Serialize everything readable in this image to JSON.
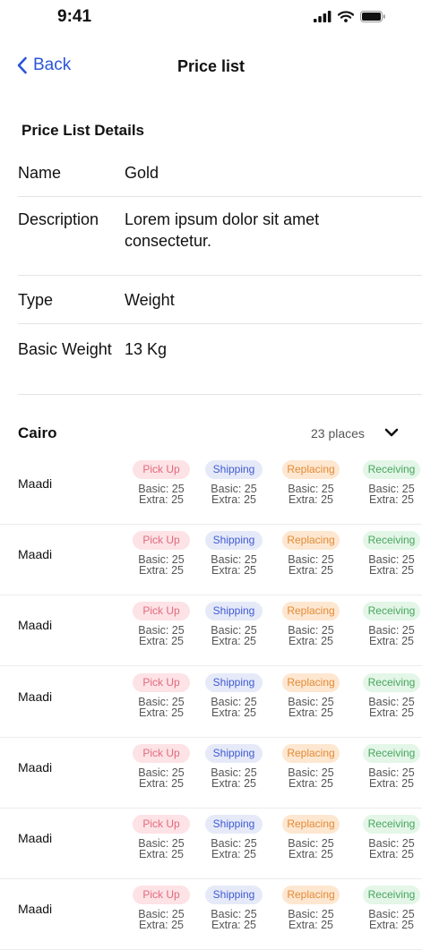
{
  "status": {
    "time": "9:41"
  },
  "nav": {
    "back_label": "Back",
    "title": "Price list"
  },
  "details": {
    "section_title": "Price List Details",
    "rows": [
      {
        "label": "Name",
        "value": "Gold"
      },
      {
        "label": "Description",
        "value": "Lorem ipsum dolor sit amet consectetur."
      },
      {
        "label": "Type",
        "value": "Weight"
      },
      {
        "label": "Basic Weight",
        "value": "13 Kg"
      }
    ]
  },
  "city": {
    "name": "Cairo",
    "count": "23 places"
  },
  "services": [
    {
      "label": "Pick Up",
      "style": "pickup"
    },
    {
      "label": "Shipping",
      "style": "ship"
    },
    {
      "label": "Replacing",
      "style": "replace"
    },
    {
      "label": "Receiving",
      "style": "recv"
    }
  ],
  "places": [
    {
      "name": "Maadi",
      "rates": [
        {
          "basic": "Basic: 25",
          "extra": "Extra: 25"
        },
        {
          "basic": "Basic: 25",
          "extra": "Extra: 25"
        },
        {
          "basic": "Basic: 25",
          "extra": "Extra: 25"
        },
        {
          "basic": "Basic: 25",
          "extra": "Extra: 25"
        }
      ]
    },
    {
      "name": "Maadi",
      "rates": [
        {
          "basic": "Basic: 25",
          "extra": "Extra: 25"
        },
        {
          "basic": "Basic: 25",
          "extra": "Extra: 25"
        },
        {
          "basic": "Basic: 25",
          "extra": "Extra: 25"
        },
        {
          "basic": "Basic: 25",
          "extra": "Extra: 25"
        }
      ]
    },
    {
      "name": "Maadi",
      "rates": [
        {
          "basic": "Basic: 25",
          "extra": "Extra: 25"
        },
        {
          "basic": "Basic: 25",
          "extra": "Extra: 25"
        },
        {
          "basic": "Basic: 25",
          "extra": "Extra: 25"
        },
        {
          "basic": "Basic: 25",
          "extra": "Extra: 25"
        }
      ]
    },
    {
      "name": "Maadi",
      "rates": [
        {
          "basic": "Basic: 25",
          "extra": "Extra: 25"
        },
        {
          "basic": "Basic: 25",
          "extra": "Extra: 25"
        },
        {
          "basic": "Basic: 25",
          "extra": "Extra: 25"
        },
        {
          "basic": "Basic: 25",
          "extra": "Extra: 25"
        }
      ]
    },
    {
      "name": "Maadi",
      "rates": [
        {
          "basic": "Basic: 25",
          "extra": "Extra: 25"
        },
        {
          "basic": "Basic: 25",
          "extra": "Extra: 25"
        },
        {
          "basic": "Basic: 25",
          "extra": "Extra: 25"
        },
        {
          "basic": "Basic: 25",
          "extra": "Extra: 25"
        }
      ]
    },
    {
      "name": "Maadi",
      "rates": [
        {
          "basic": "Basic: 25",
          "extra": "Extra: 25"
        },
        {
          "basic": "Basic: 25",
          "extra": "Extra: 25"
        },
        {
          "basic": "Basic: 25",
          "extra": "Extra: 25"
        },
        {
          "basic": "Basic: 25",
          "extra": "Extra: 25"
        }
      ]
    },
    {
      "name": "Maadi",
      "rates": [
        {
          "basic": "Basic: 25",
          "extra": "Extra: 25"
        },
        {
          "basic": "Basic: 25",
          "extra": "Extra: 25"
        },
        {
          "basic": "Basic: 25",
          "extra": "Extra: 25"
        },
        {
          "basic": "Basic: 25",
          "extra": "Extra: 25"
        }
      ]
    }
  ],
  "colors": {
    "accent": "#2B55D9",
    "pickup": "#E06B7C",
    "shipping": "#3F5BD3",
    "replacing": "#E38B36",
    "receiving": "#48A55F"
  },
  "icons": [
    "chevron-left-icon",
    "signal-icon",
    "wifi-icon",
    "battery-icon",
    "chevron-down-icon"
  ]
}
